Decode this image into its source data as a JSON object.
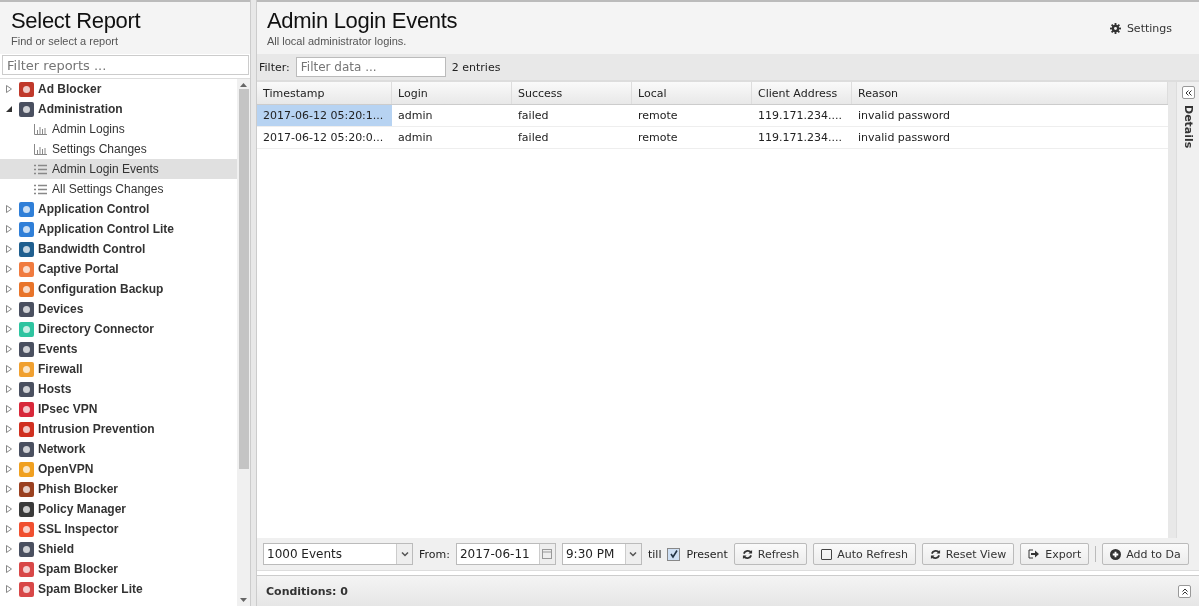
{
  "sidebar": {
    "title": "Select Report",
    "subtitle": "Find or select a report",
    "filter_placeholder": "Filter reports ...",
    "items": [
      {
        "label": "Ad Blocker",
        "color": "#c0392b",
        "expanded": false,
        "selected": false
      },
      {
        "label": "Administration",
        "color": "#4a5060",
        "expanded": true,
        "selected": false,
        "children": [
          {
            "label": "Admin Logins",
            "kind": "chart",
            "selected": false
          },
          {
            "label": "Settings Changes",
            "kind": "chart",
            "selected": false
          },
          {
            "label": "Admin Login Events",
            "kind": "list",
            "selected": true
          },
          {
            "label": "All Settings Changes",
            "kind": "list",
            "selected": false
          }
        ]
      },
      {
        "label": "Application Control",
        "color": "#2f7fd8",
        "expanded": false,
        "selected": false
      },
      {
        "label": "Application Control Lite",
        "color": "#2f7fd8",
        "expanded": false,
        "selected": false
      },
      {
        "label": "Bandwidth Control",
        "color": "#1f5f8f",
        "expanded": false,
        "selected": false
      },
      {
        "label": "Captive Portal",
        "color": "#f07b3f",
        "expanded": false,
        "selected": false
      },
      {
        "label": "Configuration Backup",
        "color": "#e8742a",
        "expanded": false,
        "selected": false
      },
      {
        "label": "Devices",
        "color": "#4a5060",
        "expanded": false,
        "selected": false
      },
      {
        "label": "Directory Connector",
        "color": "#2ec4a0",
        "expanded": false,
        "selected": false
      },
      {
        "label": "Events",
        "color": "#4a5060",
        "expanded": false,
        "selected": false
      },
      {
        "label": "Firewall",
        "color": "#f0a030",
        "expanded": false,
        "selected": false
      },
      {
        "label": "Hosts",
        "color": "#4a5060",
        "expanded": false,
        "selected": false
      },
      {
        "label": "IPsec VPN",
        "color": "#d8283a",
        "expanded": false,
        "selected": false
      },
      {
        "label": "Intrusion Prevention",
        "color": "#d03020",
        "expanded": false,
        "selected": false
      },
      {
        "label": "Network",
        "color": "#4a5060",
        "expanded": false,
        "selected": false
      },
      {
        "label": "OpenVPN",
        "color": "#f0a020",
        "expanded": false,
        "selected": false
      },
      {
        "label": "Phish Blocker",
        "color": "#9a4020",
        "expanded": false,
        "selected": false
      },
      {
        "label": "Policy Manager",
        "color": "#3a3a3a",
        "expanded": false,
        "selected": false
      },
      {
        "label": "SSL Inspector",
        "color": "#f05030",
        "expanded": false,
        "selected": false
      },
      {
        "label": "Shield",
        "color": "#4a5060",
        "expanded": false,
        "selected": false
      },
      {
        "label": "Spam Blocker",
        "color": "#d84848",
        "expanded": false,
        "selected": false
      },
      {
        "label": "Spam Blocker Lite",
        "color": "#d84848",
        "expanded": false,
        "selected": false
      }
    ]
  },
  "report": {
    "title": "Admin Login Events",
    "subtitle": "All local administrator logins.",
    "settings_label": "Settings"
  },
  "filter": {
    "label": "Filter:",
    "placeholder": "Filter data ...",
    "count": "2 entries"
  },
  "table": {
    "columns": [
      "Timestamp",
      "Login",
      "Success",
      "Local",
      "Client Address",
      "Reason"
    ],
    "rows": [
      {
        "selected": true,
        "cells": [
          "2017-06-12 05:20:1...",
          "admin",
          "failed",
          "remote",
          "119.171.234....",
          "invalid password"
        ]
      },
      {
        "selected": false,
        "cells": [
          "2017-06-12 05:20:0...",
          "admin",
          "failed",
          "remote",
          "119.171.234....",
          "invalid password"
        ]
      }
    ]
  },
  "details_label": "Details",
  "toolbar": {
    "limit": "1000 Events",
    "from_label": "From:",
    "date": "2017-06-11",
    "time": "9:30 PM",
    "till_label": "till",
    "present": {
      "label": "Present",
      "checked": true
    },
    "buttons": [
      {
        "label": "Refresh",
        "kind": "refresh"
      },
      {
        "label": "Auto Refresh",
        "kind": "checkbox",
        "checked": false
      },
      {
        "label": "Reset View",
        "kind": "refresh"
      },
      {
        "label": "Export",
        "kind": "export"
      },
      {
        "label": "Add to Da",
        "kind": "add"
      }
    ]
  },
  "conditions": "Conditions: 0"
}
